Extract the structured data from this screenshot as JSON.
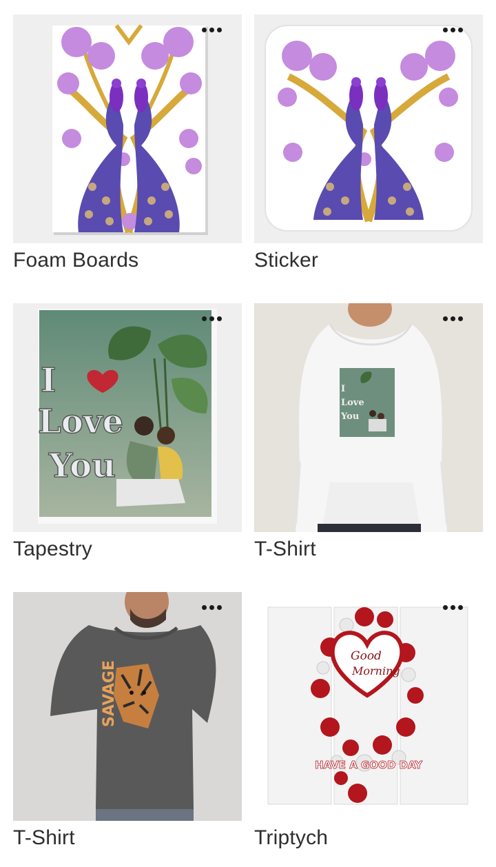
{
  "products": [
    {
      "label": "Foam Boards",
      "icon": "peacock-art-thumbnail"
    },
    {
      "label": "Sticker",
      "icon": "peacock-art-thumbnail"
    },
    {
      "label": "Tapestry",
      "icon": "couple-love-art-thumbnail"
    },
    {
      "label": "T-Shirt",
      "icon": "hoodie-couple-art-thumbnail"
    },
    {
      "label": "T-Shirt",
      "icon": "savage-tiger-tshirt-thumbnail"
    },
    {
      "label": "Triptych",
      "icon": "good-morning-roses-thumbnail"
    }
  ],
  "art_text": {
    "love_line1": "I",
    "love_line2": "Love",
    "love_line3": "You",
    "savage": "SAVAGE",
    "good": "Good",
    "morning": "Morning",
    "have_a_good_day": "HAVE A GOOD DAY"
  },
  "colors": {
    "label_text": "#2e2e2e",
    "more_dots": "#1b1b1b",
    "peacock_purple": "#7b2fbf",
    "blossom": "#c48bde",
    "gold": "#d6a93a",
    "tapestry_green": "#6f8f7e",
    "rose_red": "#b3161d"
  }
}
